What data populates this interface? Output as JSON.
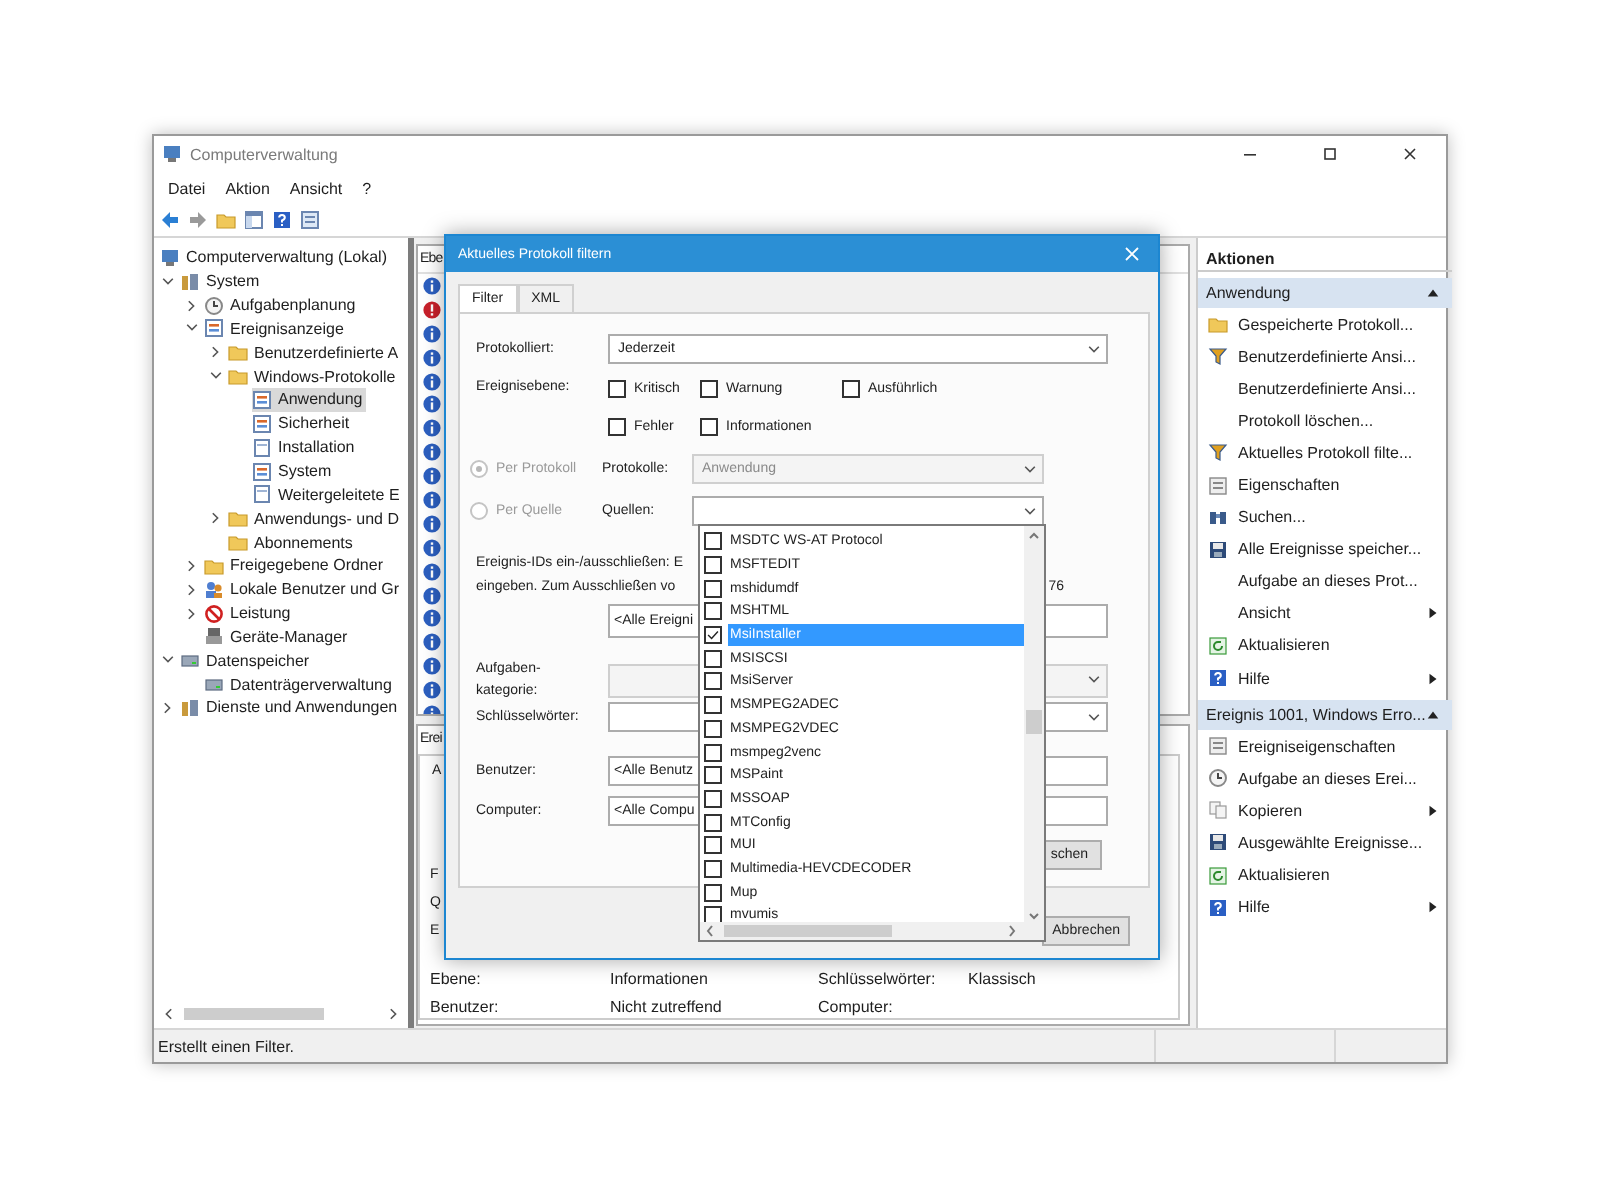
{
  "window": {
    "title": "Computerverwaltung"
  },
  "menu": [
    "Datei",
    "Aktion",
    "Ansicht",
    "?"
  ],
  "tree": [
    {
      "label": "Computerverwaltung (Lokal)",
      "kind": "computer",
      "selected": false,
      "children": [
        {
          "label": "System",
          "kind": "tools",
          "selected": false,
          "expanded": true,
          "children": [
            {
              "label": "Aufgabenplanung",
              "kind": "clock",
              "selected": false,
              "expanded": false
            },
            {
              "label": "Ereignisanzeige",
              "kind": "log",
              "selected": false,
              "expanded": true,
              "children": [
                {
                  "label": "Benutzerdefinierte A",
                  "kind": "folder",
                  "selected": false,
                  "expanded": false
                },
                {
                  "label": "Windows-Protokolle",
                  "kind": "folder",
                  "selected": false,
                  "expanded": true,
                  "children": [
                    {
                      "label": "Anwendung",
                      "kind": "log",
                      "selected": true
                    },
                    {
                      "label": "Sicherheit",
                      "kind": "log",
                      "selected": false
                    },
                    {
                      "label": "Installation",
                      "kind": "page",
                      "selected": false
                    },
                    {
                      "label": "System",
                      "kind": "log",
                      "selected": false
                    },
                    {
                      "label": "Weitergeleitete E",
                      "kind": "page",
                      "selected": false
                    }
                  ]
                },
                {
                  "label": "Anwendungs- und D",
                  "kind": "folder",
                  "selected": false,
                  "expanded": false
                },
                {
                  "label": "Abonnements",
                  "kind": "folder",
                  "selected": false
                }
              ]
            },
            {
              "label": "Freigegebene Ordner",
              "kind": "folder",
              "selected": false,
              "expanded": false
            },
            {
              "label": "Lokale Benutzer und Gr",
              "kind": "users",
              "selected": false,
              "expanded": false
            },
            {
              "label": "Leistung",
              "kind": "perf",
              "selected": false,
              "expanded": false
            },
            {
              "label": "Geräte-Manager",
              "kind": "device",
              "selected": false
            }
          ]
        },
        {
          "label": "Datenspeicher",
          "kind": "drive",
          "selected": false,
          "expanded": true,
          "children": [
            {
              "label": "Datenträgerverwaltung",
              "kind": "drive",
              "selected": false
            }
          ]
        },
        {
          "label": "Dienste und Anwendungen",
          "kind": "tools",
          "selected": false,
          "expanded": false
        }
      ]
    }
  ],
  "event_list": {
    "header": "Ebe",
    "rows": [
      {
        "kind": "info"
      },
      {
        "kind": "error"
      },
      {
        "kind": "info"
      },
      {
        "kind": "info"
      },
      {
        "kind": "info"
      },
      {
        "kind": "info"
      },
      {
        "kind": "info"
      },
      {
        "kind": "info"
      },
      {
        "kind": "info"
      },
      {
        "kind": "info"
      },
      {
        "kind": "info"
      },
      {
        "kind": "info"
      },
      {
        "kind": "info"
      },
      {
        "kind": "info"
      },
      {
        "kind": "info"
      },
      {
        "kind": "info"
      },
      {
        "kind": "info"
      },
      {
        "kind": "info"
      },
      {
        "kind": "info"
      }
    ]
  },
  "event_detail": {
    "tab": "Erei",
    "subtab": "A",
    "fragments": [
      "F",
      "Q",
      "E"
    ],
    "fields": [
      [
        {
          "label": "Ebene:",
          "value": "Informationen"
        },
        {
          "label": "Schlüsselwörter:",
          "value": "Klassisch"
        }
      ],
      [
        {
          "label": "Benutzer:",
          "value": "Nicht zutreffend"
        },
        {
          "label": "Computer:"
        }
      ]
    ]
  },
  "actions": {
    "title": "Aktionen",
    "sections": [
      {
        "title": "Anwendung",
        "expanded": true,
        "items": [
          {
            "label": "Gespeicherte Protokoll...",
            "kind": "folder",
            "submenu": false
          },
          {
            "label": "Benutzerdefinierte Ansi...",
            "kind": "filter",
            "submenu": false
          },
          {
            "label": "Benutzerdefinierte Ansi...",
            "kind": "none",
            "submenu": false
          },
          {
            "label": "Protokoll löschen...",
            "kind": "none",
            "submenu": false
          },
          {
            "label": "Aktuelles Protokoll filte...",
            "kind": "filter",
            "submenu": false
          },
          {
            "label": "Eigenschaften",
            "kind": "properties",
            "submenu": false
          },
          {
            "label": "Suchen...",
            "kind": "find",
            "submenu": false
          },
          {
            "label": "Alle Ereignisse speicher...",
            "kind": "save",
            "submenu": false
          },
          {
            "label": "Aufgabe an dieses Prot...",
            "kind": "none",
            "submenu": false
          },
          {
            "label": "Ansicht",
            "kind": "none",
            "submenu": true
          },
          {
            "label": "Aktualisieren",
            "kind": "refresh",
            "submenu": false
          },
          {
            "label": "Hilfe",
            "kind": "help",
            "submenu": true
          }
        ]
      },
      {
        "title": "Ereignis 1001, Windows Erro...",
        "expanded": true,
        "items": [
          {
            "label": "Ereigniseigenschaften",
            "kind": "properties",
            "submenu": false
          },
          {
            "label": "Aufgabe an dieses Erei...",
            "kind": "clock",
            "submenu": false
          },
          {
            "label": "Kopieren",
            "kind": "copy",
            "submenu": true
          },
          {
            "label": "Ausgewählte Ereignisse...",
            "kind": "save",
            "submenu": false
          },
          {
            "label": "Aktualisieren",
            "kind": "refresh",
            "submenu": false
          },
          {
            "label": "Hilfe",
            "kind": "help",
            "submenu": true
          }
        ]
      }
    ]
  },
  "status_bar": "Erstellt einen Filter.",
  "dialog": {
    "title": "Aktuelles Protokoll filtern",
    "tabs": [
      {
        "label": "Filter",
        "selected": true
      },
      {
        "label": "XML",
        "selected": false
      }
    ],
    "logged": {
      "label": "Protokolliert:",
      "value": "Jederzeit"
    },
    "levels": {
      "label": "Ereignisebene:",
      "options": [
        {
          "label": "Kritisch",
          "checked": false
        },
        {
          "label": "Warnung",
          "checked": false
        },
        {
          "label": "Ausführlich",
          "checked": false
        },
        {
          "label": "Fehler",
          "checked": false
        },
        {
          "label": "Informationen",
          "checked": false
        }
      ]
    },
    "scope": [
      {
        "label": "Per Protokoll",
        "selected": true,
        "disabled": true,
        "field_label": "Protokolle:",
        "value": "Anwendung",
        "field_disabled": true
      },
      {
        "label": "Per Quelle",
        "selected": false,
        "disabled": true,
        "field_label": "Quellen:",
        "field_disabled": false
      }
    ],
    "ids_hint": {
      "lines": [
        "Ereignis-IDs ein-/ausschließen: E",
        "eingeben. Zum Ausschließen vo"
      ],
      "tail": "76"
    },
    "ids_value": "<Alle Ereigni",
    "category": {
      "label": "Aufgaben-kategorie:",
      "disabled": true
    },
    "keywords": {
      "label": "Schlüsselwörter:"
    },
    "user": {
      "label": "Benutzer:",
      "value": "<Alle Benutz"
    },
    "computer": {
      "label": "Computer:",
      "value": "<Alle Compu"
    },
    "clear_button": "schen",
    "buttons": [
      "Abbrechen"
    ],
    "sources": [
      {
        "label": "MSDTC WS-AT Protocol",
        "checked": false,
        "selected": false
      },
      {
        "label": "MSFTEDIT",
        "checked": false,
        "selected": false
      },
      {
        "label": "mshidumdf",
        "checked": false,
        "selected": false
      },
      {
        "label": "MSHTML",
        "checked": false,
        "selected": false
      },
      {
        "label": "MsiInstaller",
        "checked": true,
        "selected": true
      },
      {
        "label": "MSISCSI",
        "checked": false,
        "selected": false
      },
      {
        "label": "MsiServer",
        "checked": false,
        "selected": false
      },
      {
        "label": "MSMPEG2ADEC",
        "checked": false,
        "selected": false
      },
      {
        "label": "MSMPEG2VDEC",
        "checked": false,
        "selected": false
      },
      {
        "label": "msmpeg2venc",
        "checked": false,
        "selected": false
      },
      {
        "label": "MSPaint",
        "checked": false,
        "selected": false
      },
      {
        "label": "MSSOAP",
        "checked": false,
        "selected": false
      },
      {
        "label": "MTConfig",
        "checked": false,
        "selected": false
      },
      {
        "label": "MUI",
        "checked": false,
        "selected": false
      },
      {
        "label": "Multimedia-HEVCDECODER",
        "checked": false,
        "selected": false
      },
      {
        "label": "Mup",
        "checked": false,
        "selected": false
      },
      {
        "label": "mvumis",
        "checked": false,
        "selected": false
      }
    ]
  }
}
